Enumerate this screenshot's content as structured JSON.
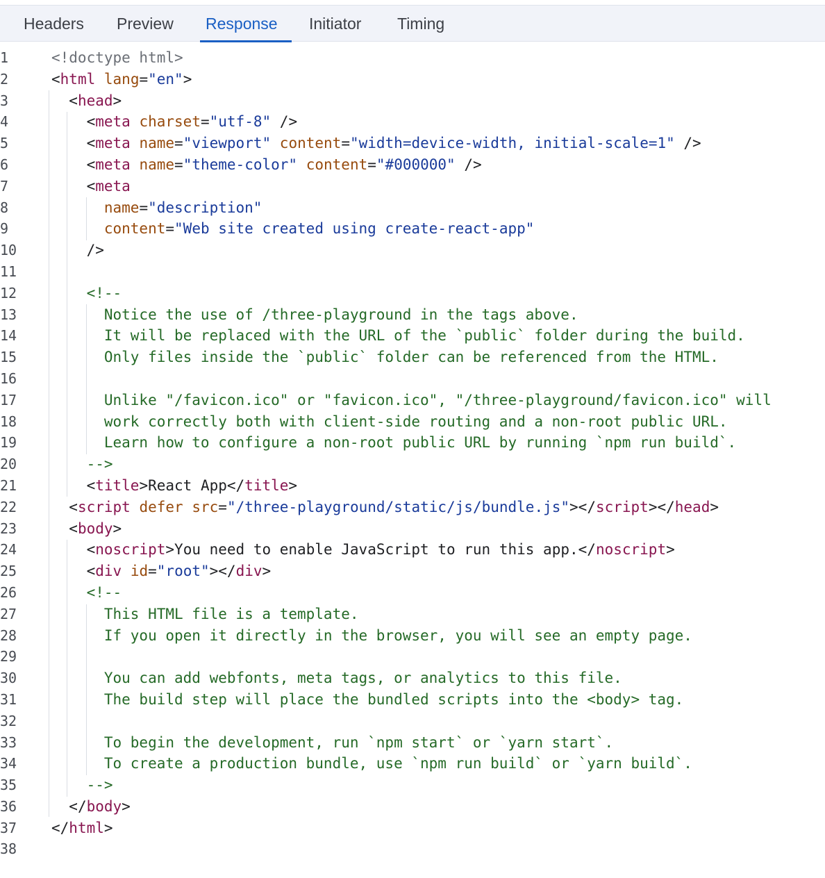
{
  "tabs": [
    {
      "label": "Headers",
      "active": false
    },
    {
      "label": "Preview",
      "active": false
    },
    {
      "label": "Response",
      "active": true
    },
    {
      "label": "Initiator",
      "active": false
    },
    {
      "label": "Timing",
      "active": false
    }
  ],
  "colors": {
    "accent": "#1a5fc4",
    "tag": "#881650",
    "attribute": "#974b0e",
    "string": "#1a3b9a",
    "comment": "#256a27",
    "doctype": "#6b6f76"
  },
  "lines": [
    {
      "n": "1",
      "t": [
        [
          "doctype",
          "<!doctype html>"
        ]
      ]
    },
    {
      "n": "2",
      "t": [
        [
          "punct",
          "<"
        ],
        [
          "tag",
          "html"
        ],
        [
          "text",
          " "
        ],
        [
          "attr",
          "lang"
        ],
        [
          "punct",
          "="
        ],
        [
          "str",
          "\"en\""
        ],
        [
          "punct",
          ">"
        ]
      ]
    },
    {
      "n": "3",
      "t": [
        [
          "text",
          "  "
        ],
        [
          "punct",
          "<"
        ],
        [
          "tag",
          "head"
        ],
        [
          "punct",
          ">"
        ]
      ]
    },
    {
      "n": "4",
      "t": [
        [
          "text",
          "    "
        ],
        [
          "punct",
          "<"
        ],
        [
          "tag",
          "meta"
        ],
        [
          "text",
          " "
        ],
        [
          "attr",
          "charset"
        ],
        [
          "punct",
          "="
        ],
        [
          "str",
          "\"utf-8\""
        ],
        [
          "punct",
          " />"
        ]
      ]
    },
    {
      "n": "5",
      "t": [
        [
          "text",
          "    "
        ],
        [
          "punct",
          "<"
        ],
        [
          "tag",
          "meta"
        ],
        [
          "text",
          " "
        ],
        [
          "attr",
          "name"
        ],
        [
          "punct",
          "="
        ],
        [
          "str",
          "\"viewport\""
        ],
        [
          "text",
          " "
        ],
        [
          "attr",
          "content"
        ],
        [
          "punct",
          "="
        ],
        [
          "str",
          "\"width=device-width, initial-scale=1\""
        ],
        [
          "punct",
          " />"
        ]
      ]
    },
    {
      "n": "6",
      "t": [
        [
          "text",
          "    "
        ],
        [
          "punct",
          "<"
        ],
        [
          "tag",
          "meta"
        ],
        [
          "text",
          " "
        ],
        [
          "attr",
          "name"
        ],
        [
          "punct",
          "="
        ],
        [
          "str",
          "\"theme-color\""
        ],
        [
          "text",
          " "
        ],
        [
          "attr",
          "content"
        ],
        [
          "punct",
          "="
        ],
        [
          "str",
          "\"#000000\""
        ],
        [
          "punct",
          " />"
        ]
      ]
    },
    {
      "n": "7",
      "t": [
        [
          "text",
          "    "
        ],
        [
          "punct",
          "<"
        ],
        [
          "tag",
          "meta"
        ]
      ]
    },
    {
      "n": "8",
      "t": [
        [
          "text",
          "      "
        ],
        [
          "attr",
          "name"
        ],
        [
          "punct",
          "="
        ],
        [
          "str",
          "\"description\""
        ]
      ]
    },
    {
      "n": "9",
      "t": [
        [
          "text",
          "      "
        ],
        [
          "attr",
          "content"
        ],
        [
          "punct",
          "="
        ],
        [
          "str",
          "\"Web site created using create-react-app\""
        ]
      ]
    },
    {
      "n": "10",
      "t": [
        [
          "text",
          "    "
        ],
        [
          "punct",
          "/>"
        ]
      ]
    },
    {
      "n": "11",
      "t": []
    },
    {
      "n": "12",
      "t": [
        [
          "text",
          "    "
        ],
        [
          "comment",
          "<!--"
        ]
      ]
    },
    {
      "n": "13",
      "t": [
        [
          "comment",
          "      Notice the use of /three-playground in the tags above."
        ]
      ]
    },
    {
      "n": "14",
      "t": [
        [
          "comment",
          "      It will be replaced with the URL of the `public` folder during the build."
        ]
      ]
    },
    {
      "n": "15",
      "t": [
        [
          "comment",
          "      Only files inside the `public` folder can be referenced from the HTML."
        ]
      ]
    },
    {
      "n": "16",
      "t": []
    },
    {
      "n": "17",
      "t": [
        [
          "comment",
          "      Unlike \"/favicon.ico\" or \"favicon.ico\", \"/three-playground/favicon.ico\" will"
        ]
      ]
    },
    {
      "n": "18",
      "t": [
        [
          "comment",
          "      work correctly both with client-side routing and a non-root public URL."
        ]
      ]
    },
    {
      "n": "19",
      "t": [
        [
          "comment",
          "      Learn how to configure a non-root public URL by running `npm run build`."
        ]
      ]
    },
    {
      "n": "20",
      "t": [
        [
          "comment",
          "    -->"
        ]
      ]
    },
    {
      "n": "21",
      "t": [
        [
          "text",
          "    "
        ],
        [
          "punct",
          "<"
        ],
        [
          "tag",
          "title"
        ],
        [
          "punct",
          ">"
        ],
        [
          "text",
          "React App"
        ],
        [
          "punct",
          "</"
        ],
        [
          "tag",
          "title"
        ],
        [
          "punct",
          ">"
        ]
      ]
    },
    {
      "n": "22",
      "t": [
        [
          "text",
          "  "
        ],
        [
          "punct",
          "<"
        ],
        [
          "tag",
          "script"
        ],
        [
          "text",
          " "
        ],
        [
          "attr",
          "defer"
        ],
        [
          "text",
          " "
        ],
        [
          "attr",
          "src"
        ],
        [
          "punct",
          "="
        ],
        [
          "str",
          "\"/three-playground/static/js/bundle.js\""
        ],
        [
          "punct",
          "></"
        ],
        [
          "tag",
          "script"
        ],
        [
          "punct",
          "></"
        ],
        [
          "tag",
          "head"
        ],
        [
          "punct",
          ">"
        ]
      ]
    },
    {
      "n": "23",
      "t": [
        [
          "text",
          "  "
        ],
        [
          "punct",
          "<"
        ],
        [
          "tag",
          "body"
        ],
        [
          "punct",
          ">"
        ]
      ]
    },
    {
      "n": "24",
      "t": [
        [
          "text",
          "    "
        ],
        [
          "punct",
          "<"
        ],
        [
          "tag",
          "noscript"
        ],
        [
          "punct",
          ">"
        ],
        [
          "text",
          "You need to enable JavaScript to run this app."
        ],
        [
          "punct",
          "</"
        ],
        [
          "tag",
          "noscript"
        ],
        [
          "punct",
          ">"
        ]
      ]
    },
    {
      "n": "25",
      "t": [
        [
          "text",
          "    "
        ],
        [
          "punct",
          "<"
        ],
        [
          "tag",
          "div"
        ],
        [
          "text",
          " "
        ],
        [
          "attr",
          "id"
        ],
        [
          "punct",
          "="
        ],
        [
          "str",
          "\"root\""
        ],
        [
          "punct",
          "></"
        ],
        [
          "tag",
          "div"
        ],
        [
          "punct",
          ">"
        ]
      ]
    },
    {
      "n": "26",
      "t": [
        [
          "text",
          "    "
        ],
        [
          "comment",
          "<!--"
        ]
      ]
    },
    {
      "n": "27",
      "t": [
        [
          "comment",
          "      This HTML file is a template."
        ]
      ]
    },
    {
      "n": "28",
      "t": [
        [
          "comment",
          "      If you open it directly in the browser, you will see an empty page."
        ]
      ]
    },
    {
      "n": "29",
      "t": []
    },
    {
      "n": "30",
      "t": [
        [
          "comment",
          "      You can add webfonts, meta tags, or analytics to this file."
        ]
      ]
    },
    {
      "n": "31",
      "t": [
        [
          "comment",
          "      The build step will place the bundled scripts into the <body> tag."
        ]
      ]
    },
    {
      "n": "32",
      "t": []
    },
    {
      "n": "33",
      "t": [
        [
          "comment",
          "      To begin the development, run `npm start` or `yarn start`."
        ]
      ]
    },
    {
      "n": "34",
      "t": [
        [
          "comment",
          "      To create a production bundle, use `npm run build` or `yarn build`."
        ]
      ]
    },
    {
      "n": "35",
      "t": [
        [
          "comment",
          "    -->"
        ]
      ]
    },
    {
      "n": "36",
      "t": [
        [
          "text",
          "  "
        ],
        [
          "punct",
          "</"
        ],
        [
          "tag",
          "body"
        ],
        [
          "punct",
          ">"
        ]
      ]
    },
    {
      "n": "37",
      "t": [
        [
          "punct",
          "</"
        ],
        [
          "tag",
          "html"
        ],
        [
          "punct",
          ">"
        ]
      ]
    },
    {
      "n": "38",
      "t": []
    }
  ]
}
